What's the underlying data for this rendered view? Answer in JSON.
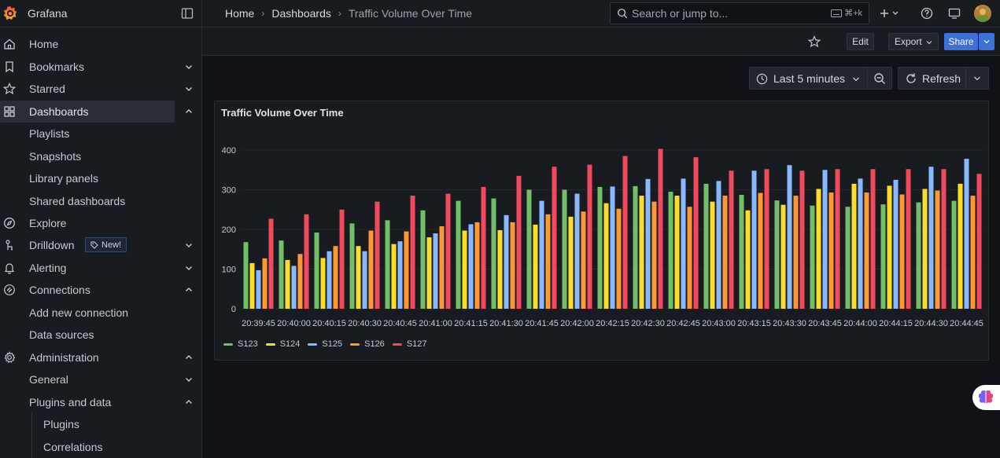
{
  "app": {
    "name": "Grafana"
  },
  "breadcrumb": {
    "items": [
      "Home",
      "Dashboards",
      "Traffic Volume Over Time"
    ]
  },
  "search": {
    "placeholder": "Search or jump to...",
    "shortcut": "⌘+k"
  },
  "sidebar": {
    "items": [
      {
        "label": "Home",
        "icon": "home-icon"
      },
      {
        "label": "Bookmarks",
        "icon": "bookmark-icon"
      },
      {
        "label": "Starred",
        "icon": "star-icon"
      },
      {
        "label": "Dashboards",
        "icon": "dashboards-icon"
      },
      {
        "label": "Playlists"
      },
      {
        "label": "Snapshots"
      },
      {
        "label": "Library panels"
      },
      {
        "label": "Shared dashboards"
      },
      {
        "label": "Explore",
        "icon": "compass-icon"
      },
      {
        "label": "Drilldown",
        "icon": "drilldown-icon",
        "badge": "New!"
      },
      {
        "label": "Alerting",
        "icon": "bell-icon"
      },
      {
        "label": "Connections",
        "icon": "link-icon"
      },
      {
        "label": "Add new connection"
      },
      {
        "label": "Data sources"
      },
      {
        "label": "Administration",
        "icon": "gear-icon"
      },
      {
        "label": "General"
      },
      {
        "label": "Plugins and data"
      },
      {
        "label": "Plugins"
      },
      {
        "label": "Correlations"
      }
    ]
  },
  "toolbar": {
    "edit": "Edit",
    "export": "Export",
    "share": "Share"
  },
  "time": {
    "range": "Last 5 minutes",
    "refresh": "Refresh"
  },
  "panel": {
    "title": "Traffic Volume Over Time"
  },
  "colors": {
    "S123": "#73bf69",
    "S124": "#fade2a",
    "S125": "#8ab8ff",
    "S126": "#ff9830",
    "S127": "#f2495c"
  },
  "chart_data": {
    "type": "bar",
    "title": "Traffic Volume Over Time",
    "xlabel": "",
    "ylabel": "",
    "ylim": [
      0,
      400
    ],
    "yticks": [
      0,
      100,
      200,
      300,
      400
    ],
    "grid": true,
    "legend": "bottom-left",
    "categories": [
      "20:39:45",
      "20:40:00",
      "20:40:15",
      "20:40:30",
      "20:40:45",
      "20:41:00",
      "20:41:15",
      "20:41:30",
      "20:41:45",
      "20:42:00",
      "20:42:15",
      "20:42:30",
      "20:42:45",
      "20:43:00",
      "20:43:15",
      "20:43:30",
      "20:43:45",
      "20:44:00",
      "20:44:15",
      "20:44:30",
      "20:44:45"
    ],
    "series": [
      {
        "name": "S123",
        "values": [
          168,
          172,
          192,
          215,
          223,
          248,
          272,
          278,
          300,
          300,
          307,
          309,
          295,
          315,
          287,
          273,
          260,
          257,
          263,
          268,
          272
        ]
      },
      {
        "name": "S124",
        "values": [
          115,
          123,
          128,
          158,
          163,
          180,
          197,
          198,
          212,
          232,
          266,
          285,
          285,
          270,
          248,
          262,
          302,
          315,
          310,
          302,
          315
        ]
      },
      {
        "name": "S125",
        "values": [
          97,
          108,
          145,
          145,
          170,
          190,
          213,
          236,
          272,
          290,
          308,
          327,
          328,
          322,
          348,
          362,
          350,
          328,
          325,
          358,
          378
        ]
      },
      {
        "name": "S126",
        "values": [
          127,
          138,
          158,
          197,
          195,
          208,
          218,
          218,
          238,
          245,
          252,
          270,
          257,
          285,
          292,
          285,
          293,
          293,
          288,
          298,
          285
        ]
      },
      {
        "name": "S127",
        "values": [
          227,
          238,
          250,
          270,
          285,
          290,
          307,
          335,
          358,
          363,
          385,
          403,
          382,
          348,
          352,
          348,
          352,
          352,
          352,
          352,
          340
        ]
      }
    ]
  }
}
